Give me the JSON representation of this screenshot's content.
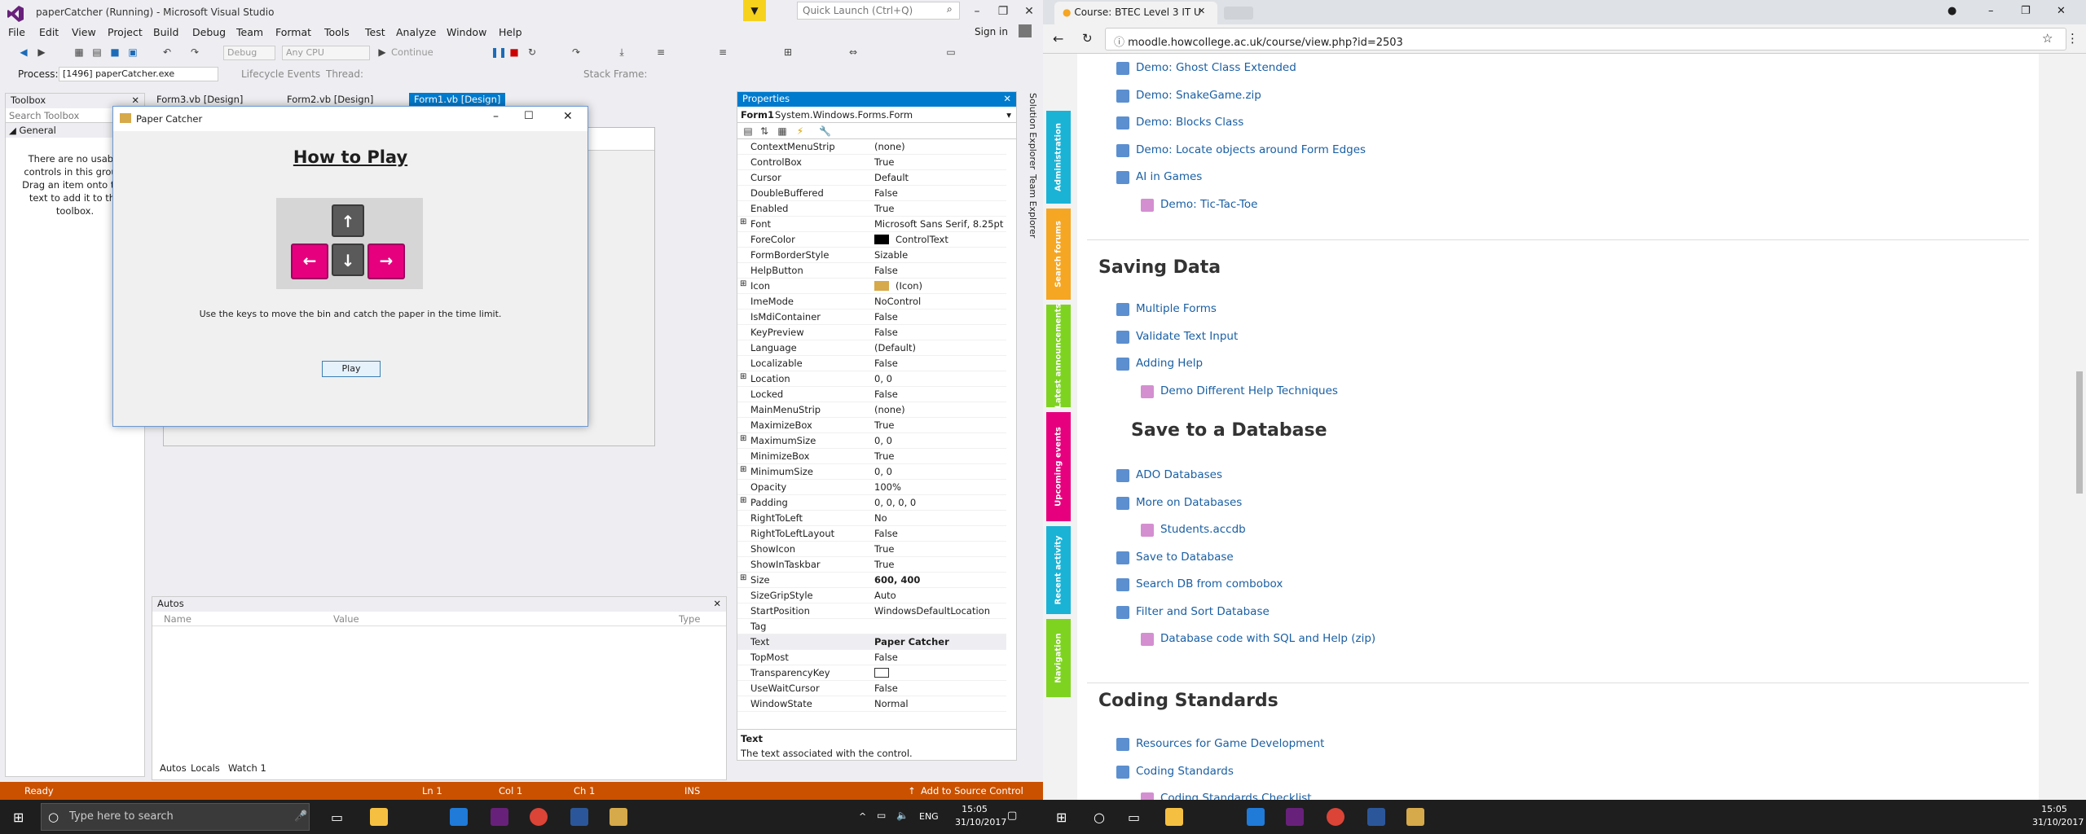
{
  "vs": {
    "title": "paperCatcher (Running) - Microsoft Visual Studio",
    "menu": [
      "File",
      "Edit",
      "View",
      "Project",
      "Build",
      "Debug",
      "Team",
      "Format",
      "Tools",
      "Test",
      "Analyze",
      "Window",
      "Help"
    ],
    "quick_launch_placeholder": "Quick Launch (Ctrl+Q)",
    "sign_in": "Sign in",
    "toolbar": {
      "config": "Debug",
      "platform": "Any CPU",
      "continue_label": "Continue"
    },
    "process_label": "Process:",
    "process_value": "[1496] paperCatcher.exe",
    "lifecycle_label": "Lifecycle Events",
    "thread_label": "Thread:",
    "stack_label": "Stack Frame:",
    "toolbox": {
      "title": "Toolbox",
      "search_placeholder": "Search Toolbox",
      "group": "General",
      "empty_message": "There are no usable controls in this group. Drag an item onto this text to add it to the toolbox."
    },
    "doc_tabs": [
      "Form3.vb [Design]",
      "Form2.vb [Design]",
      "Form1.vb [Design]"
    ],
    "paper_catcher": {
      "title": "Paper Catcher",
      "heading": "How to Play",
      "instructions": "Use the keys to move the bin and catch the paper in the time limit.",
      "play_button": "Play"
    },
    "autos": {
      "title": "Autos",
      "columns": [
        "Name",
        "Value",
        "Type"
      ],
      "tabs": [
        "Autos",
        "Locals",
        "Watch 1"
      ]
    },
    "properties": {
      "title": "Properties",
      "object_name": "Form1",
      "object_type": "System.Windows.Forms.Form",
      "rows": [
        {
          "name": "ContextMenuStrip",
          "value": "(none)"
        },
        {
          "name": "ControlBox",
          "value": "True"
        },
        {
          "name": "Cursor",
          "value": "Default"
        },
        {
          "name": "DoubleBuffered",
          "value": "False"
        },
        {
          "name": "Enabled",
          "value": "True"
        },
        {
          "name": "Font",
          "value": "Microsoft Sans Serif, 8.25pt"
        },
        {
          "name": "ForeColor",
          "value": "ControlText"
        },
        {
          "name": "FormBorderStyle",
          "value": "Sizable"
        },
        {
          "name": "HelpButton",
          "value": "False"
        },
        {
          "name": "Icon",
          "value": "(Icon)"
        },
        {
          "name": "ImeMode",
          "value": "NoControl"
        },
        {
          "name": "IsMdiContainer",
          "value": "False"
        },
        {
          "name": "KeyPreview",
          "value": "False"
        },
        {
          "name": "Language",
          "value": "(Default)"
        },
        {
          "name": "Localizable",
          "value": "False"
        },
        {
          "name": "Location",
          "value": "0, 0"
        },
        {
          "name": "Locked",
          "value": "False"
        },
        {
          "name": "MainMenuStrip",
          "value": "(none)"
        },
        {
          "name": "MaximizeBox",
          "value": "True"
        },
        {
          "name": "MaximumSize",
          "value": "0, 0"
        },
        {
          "name": "MinimizeBox",
          "value": "True"
        },
        {
          "name": "MinimumSize",
          "value": "0, 0"
        },
        {
          "name": "Opacity",
          "value": "100%"
        },
        {
          "name": "Padding",
          "value": "0, 0, 0, 0"
        },
        {
          "name": "RightToLeft",
          "value": "No"
        },
        {
          "name": "RightToLeftLayout",
          "value": "False"
        },
        {
          "name": "ShowIcon",
          "value": "True"
        },
        {
          "name": "ShowInTaskbar",
          "value": "True"
        },
        {
          "name": "Size",
          "value": "600, 400"
        },
        {
          "name": "SizeGripStyle",
          "value": "Auto"
        },
        {
          "name": "StartPosition",
          "value": "WindowsDefaultLocation"
        },
        {
          "name": "Tag",
          "value": ""
        },
        {
          "name": "Text",
          "value": "Paper Catcher"
        },
        {
          "name": "TopMost",
          "value": "False"
        },
        {
          "name": "TransparencyKey",
          "value": ""
        },
        {
          "name": "UseWaitCursor",
          "value": "False"
        },
        {
          "name": "WindowState",
          "value": "Normal"
        }
      ],
      "desc_title": "Text",
      "desc_text": "The text associated with the control."
    },
    "side_tabs": [
      "Solution Explorer",
      "Team Explorer"
    ],
    "status": {
      "ready": "Ready",
      "ln": "Ln 1",
      "col": "Col 1",
      "ch": "Ch 1",
      "ins": "INS",
      "source_control": "Add to Source Control"
    },
    "accent": "#007acc",
    "status_color": "#ca5100"
  },
  "taskbar": {
    "search_placeholder": "Type here to search",
    "lang": "ENG",
    "time": "15:05",
    "date": "31/10/2017"
  },
  "chrome": {
    "tab_title": "Course: BTEC Level 3 IT U",
    "url": "moodle.howcollege.ac.uk/course/view.php?id=2503",
    "side_blocks": [
      {
        "label": "Administration",
        "color": "#1ab3d6"
      },
      {
        "label": "Search forums",
        "color": "#f5a623"
      },
      {
        "label": "Latest announcements",
        "color": "#7ed321"
      },
      {
        "label": "Upcoming events",
        "color": "#e6007e"
      },
      {
        "label": "Recent activity",
        "color": "#1ab3d6"
      },
      {
        "label": "Navigation",
        "color": "#7ed321"
      }
    ],
    "top_items": [
      {
        "label": "Demo: Ghost Class Extended",
        "indent": 0
      },
      {
        "label": "Demo: SnakeGame.zip",
        "indent": 0
      },
      {
        "label": "Demo: Blocks Class",
        "indent": 0
      },
      {
        "label": "Demo: Locate objects around Form Edges",
        "indent": 0
      },
      {
        "label": "AI in Games",
        "indent": 0
      },
      {
        "label": "Demo: Tic-Tac-Toe",
        "indent": 1
      }
    ],
    "saving_heading": "Saving Data",
    "saving_items": [
      {
        "label": "Multiple Forms",
        "indent": 0
      },
      {
        "label": "Validate Text Input",
        "indent": 0
      },
      {
        "label": "Adding Help",
        "indent": 0
      },
      {
        "label": "Demo Different Help Techniques",
        "indent": 1
      }
    ],
    "db_heading": "Save to a Database",
    "db_items": [
      {
        "label": "ADO Databases",
        "indent": 0
      },
      {
        "label": "More on Databases",
        "indent": 0
      },
      {
        "label": "Students.accdb",
        "indent": 1
      },
      {
        "label": "Save to Database",
        "indent": 0
      },
      {
        "label": "Search DB from combobox",
        "indent": 0
      },
      {
        "label": "Filter and Sort Database",
        "indent": 0
      },
      {
        "label": "Database code with SQL and Help (zip)",
        "indent": 1
      }
    ],
    "coding_heading": "Coding Standards",
    "coding_items": [
      {
        "label": "Resources for Game Development",
        "indent": 0
      },
      {
        "label": "Coding Standards",
        "indent": 0
      },
      {
        "label": "Coding Standards Checklist",
        "indent": 1
      }
    ]
  }
}
